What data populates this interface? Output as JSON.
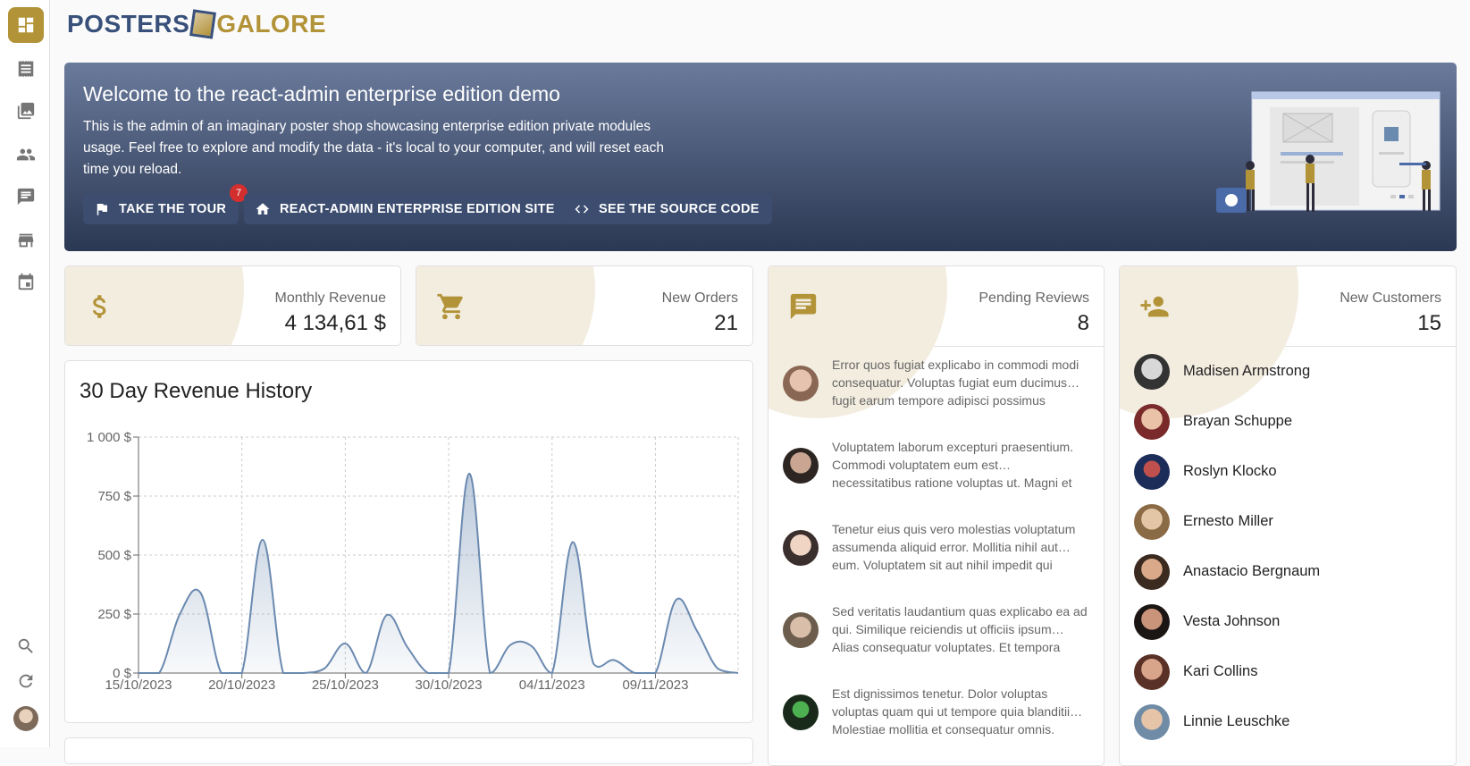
{
  "logo": {
    "part1": "POSTERS",
    "part2": "GALORE"
  },
  "sidebar": {
    "items": [
      {
        "name": "dashboard",
        "icon": "dashboard-icon",
        "active": true
      },
      {
        "name": "orders",
        "icon": "receipt-icon"
      },
      {
        "name": "posters",
        "icon": "collections-icon"
      },
      {
        "name": "customers",
        "icon": "people-icon"
      },
      {
        "name": "reviews",
        "icon": "comment-icon"
      },
      {
        "name": "stores",
        "icon": "store-icon"
      },
      {
        "name": "events",
        "icon": "event-icon"
      }
    ],
    "bottom": [
      {
        "name": "search",
        "icon": "search-icon"
      },
      {
        "name": "refresh",
        "icon": "refresh-icon"
      }
    ]
  },
  "banner": {
    "title": "Welcome to the react-admin enterprise edition demo",
    "text": "This is the admin of an imaginary poster shop showcasing enterprise edition private modules usage. Feel free to explore and modify the data - it's local to your computer, and will reset each time you reload.",
    "buttons": {
      "tour": "TAKE THE TOUR",
      "tour_badge": "7",
      "site": "REACT-ADMIN ENTERPRISE EDITION SITE",
      "source": "SEE THE SOURCE CODE"
    }
  },
  "stats": {
    "revenue": {
      "label": "Monthly Revenue",
      "value": "4 134,61 $"
    },
    "orders": {
      "label": "New Orders",
      "value": "21"
    },
    "reviews": {
      "label": "Pending Reviews",
      "value": "8"
    },
    "customers": {
      "label": "New Customers",
      "value": "15"
    }
  },
  "revenue_chart": {
    "title": "30 Day Revenue History"
  },
  "chart_data": {
    "type": "area",
    "title": "30 Day Revenue History",
    "xlabel": "",
    "ylabel": "",
    "x_tick_labels": [
      "15/10/2023",
      "20/10/2023",
      "25/10/2023",
      "30/10/2023",
      "04/11/2023",
      "09/11/2023"
    ],
    "y_tick_labels": [
      "0 $",
      "250 $",
      "500 $",
      "750 $",
      "1 000 $"
    ],
    "ylim": [
      0,
      1000
    ],
    "x": [
      "15/10/2023",
      "16/10/2023",
      "17/10/2023",
      "18/10/2023",
      "19/10/2023",
      "20/10/2023",
      "21/10/2023",
      "22/10/2023",
      "23/10/2023",
      "24/10/2023",
      "25/10/2023",
      "26/10/2023",
      "27/10/2023",
      "28/10/2023",
      "29/10/2023",
      "30/10/2023",
      "31/10/2023",
      "01/11/2023",
      "02/11/2023",
      "03/11/2023",
      "04/11/2023",
      "05/11/2023",
      "06/11/2023",
      "07/11/2023",
      "08/11/2023",
      "09/11/2023",
      "10/11/2023",
      "11/11/2023",
      "12/11/2023",
      "13/11/2023"
    ],
    "values": [
      0,
      0,
      250,
      340,
      0,
      0,
      565,
      0,
      0,
      20,
      125,
      0,
      245,
      110,
      0,
      0,
      845,
      0,
      120,
      115,
      0,
      555,
      40,
      55,
      0,
      0,
      310,
      180,
      20,
      0
    ],
    "grid": true,
    "color": "#6b8ab0"
  },
  "reviews": [
    {
      "text": "Error quos fugiat explicabo in commodi modi consequatur. Voluptas fugiat eum ducimus… fugit earum tempore adipisci possimus",
      "avatar": "avatar-icon"
    },
    {
      "text": "Voluptatem laborum excepturi praesentium. Commodi voluptatem eum est… necessitatibus ratione voluptas ut. Magni et",
      "avatar": "avatar-icon"
    },
    {
      "text": "Tenetur eius quis vero molestias voluptatum assumenda aliquid error. Mollitia nihil aut… eum. Voluptatem sit aut nihil impedit qui",
      "avatar": "avatar-icon"
    },
    {
      "text": "Sed veritatis laudantium quas explicabo ea ad qui. Similique reiciendis ut officiis ipsum… Alias consequatur voluptates. Et tempora",
      "avatar": "avatar-icon"
    },
    {
      "text": "Est dignissimos tenetur. Dolor voluptas voluptas quam qui ut tempore quia blanditii… Molestiae mollitia et consequatur omnis.",
      "avatar": "avatar-icon"
    }
  ],
  "customers": [
    {
      "name": "Madisen Armstrong"
    },
    {
      "name": "Brayan Schuppe"
    },
    {
      "name": "Roslyn Klocko"
    },
    {
      "name": "Ernesto Miller"
    },
    {
      "name": "Anastacio Bergnaum"
    },
    {
      "name": "Vesta Johnson"
    },
    {
      "name": "Kari Collins"
    },
    {
      "name": "Linnie Leuschke"
    }
  ],
  "colors": {
    "accent": "#b29338",
    "navy": "#38507a",
    "banner_top": "#6a7a9b",
    "banner_bottom": "#2b3853"
  }
}
